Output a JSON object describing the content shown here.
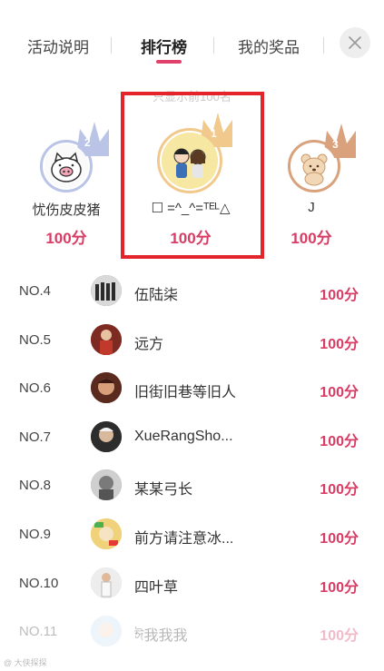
{
  "tabs": [
    {
      "label": "活动说明"
    },
    {
      "label": "排行榜"
    },
    {
      "label": "我的奖品"
    }
  ],
  "notice": "只显示前100名",
  "podium": [
    {
      "rank": "2",
      "name": "忧伤皮皮猪",
      "score": "100分",
      "avatar": "pig-avatar",
      "crown_color": "#b9c4e6"
    },
    {
      "rank": "1",
      "name": "☐ =^_^=ᵀᴱᴸ△",
      "score": "100分",
      "avatar": "couple-avatar",
      "crown_color": "#f2c98d"
    },
    {
      "rank": "3",
      "name": "J",
      "score": "100分",
      "avatar": "bear-avatar",
      "crown_color": "#d9a27c"
    }
  ],
  "list": [
    {
      "rank": "NO.4",
      "name": "伍陆柒",
      "score": "100分",
      "avatar_color": "#6b6b6b"
    },
    {
      "rank": "NO.5",
      "name": "远方",
      "score": "100分",
      "avatar_color": "#9c3b2f"
    },
    {
      "rank": "NO.6",
      "name": "旧街旧巷等旧人",
      "score": "100分",
      "avatar_color": "#7a3326"
    },
    {
      "rank": "NO.7",
      "name": "XueRangSho...",
      "score": "100分",
      "avatar_color": "#3b3b3b"
    },
    {
      "rank": "NO.8",
      "name": "某某弓长",
      "score": "100分",
      "avatar_color": "#8a8a8a"
    },
    {
      "rank": "NO.9",
      "name": "前方请注意冰...",
      "score": "100分",
      "avatar_color": "#d9b04a"
    },
    {
      "rank": "NO.10",
      "name": "四叶草",
      "score": "100分",
      "avatar_color": "#c9c9c9"
    },
    {
      "rank": "NO.11",
      "name": "ঈ我我我",
      "score": "100分",
      "avatar_color": "#9fc3e0"
    }
  ],
  "watermark": "@ 大侠探探",
  "colors": {
    "accent": "#d83c64",
    "highlight": "#e3242b"
  }
}
